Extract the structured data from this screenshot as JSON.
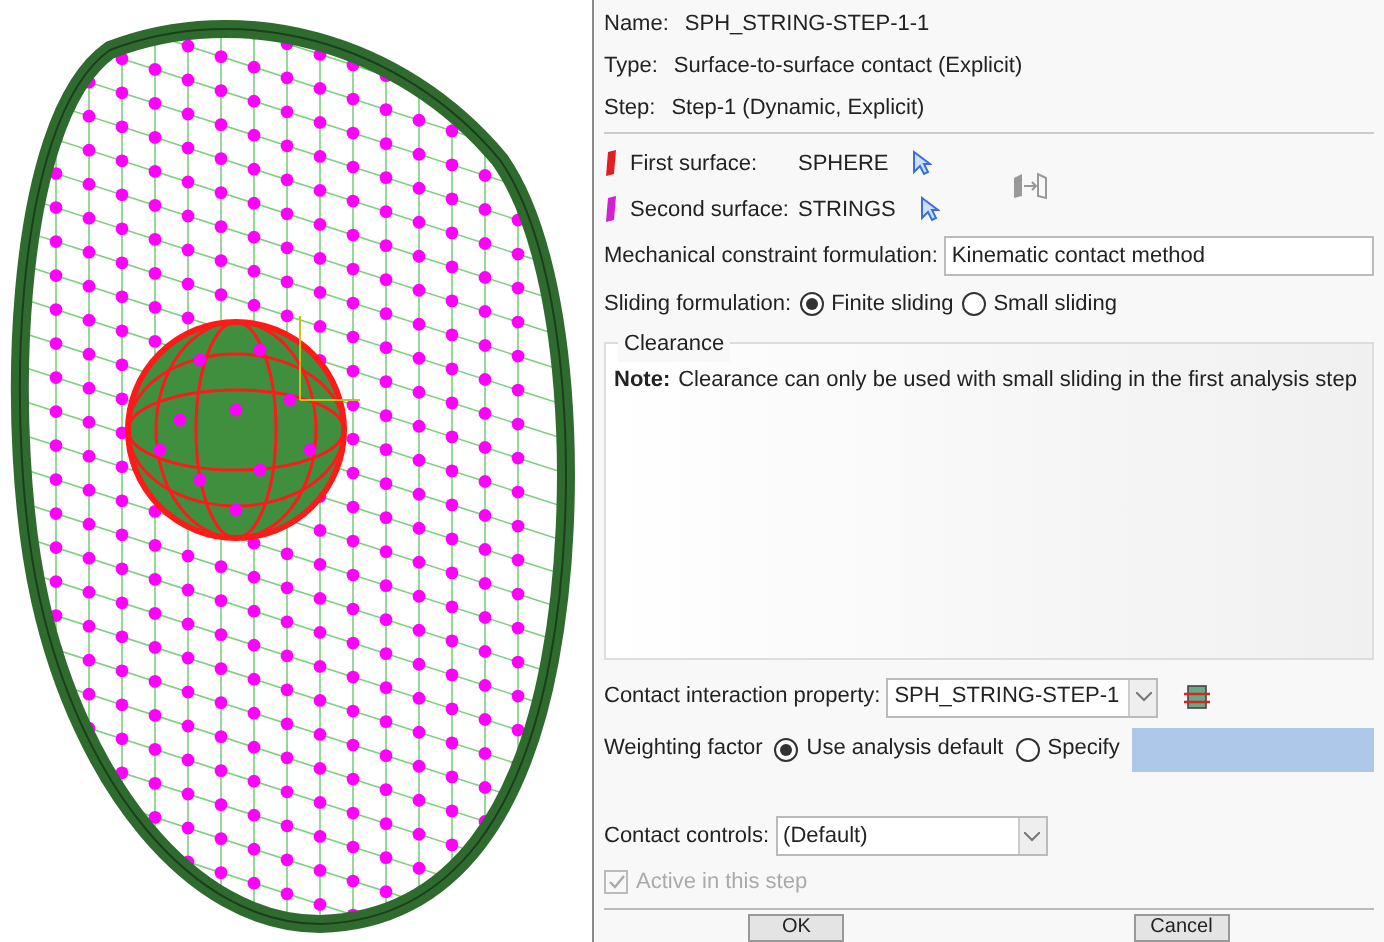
{
  "info": [
    {
      "label": "Name:",
      "value": "SPH_STRING-STEP-1-1"
    },
    {
      "label": "Type:",
      "value": "Surface-to-surface contact (Explicit)"
    },
    {
      "label": "Step:",
      "value": "Step-1 (Dynamic, Explicit)"
    }
  ],
  "surfaces": [
    {
      "label": "First surface:",
      "value": "SPHERE",
      "color": "#e02020"
    },
    {
      "label": "Second surface:",
      "value": "STRINGS",
      "color": "#d020d0"
    }
  ],
  "mechanical_constraint": {
    "label": "Mechanical constraint formulation:",
    "value": "Kinematic contact method"
  },
  "sliding": {
    "label": "Sliding formulation:",
    "options": [
      {
        "label": "Finite sliding",
        "selected": true
      },
      {
        "label": "Small sliding",
        "selected": false
      }
    ]
  },
  "clearance": {
    "title": "Clearance",
    "note_label": "Note:",
    "note": "Clearance can only be used with small sliding in the first analysis step"
  },
  "contact_property": {
    "label": "Contact interaction property:",
    "value": "SPH_STRING-STEP-1"
  },
  "weighting": {
    "label": "Weighting factor",
    "options": [
      {
        "label": "Use analysis default",
        "selected": true
      },
      {
        "label": "Specify",
        "selected": false
      }
    ]
  },
  "contact_controls": {
    "label": "Contact controls:",
    "value": "(Default)"
  },
  "active": {
    "label": "Active in this step",
    "checked": true,
    "disabled": true
  },
  "buttons": [
    "OK",
    "Cancel"
  ]
}
